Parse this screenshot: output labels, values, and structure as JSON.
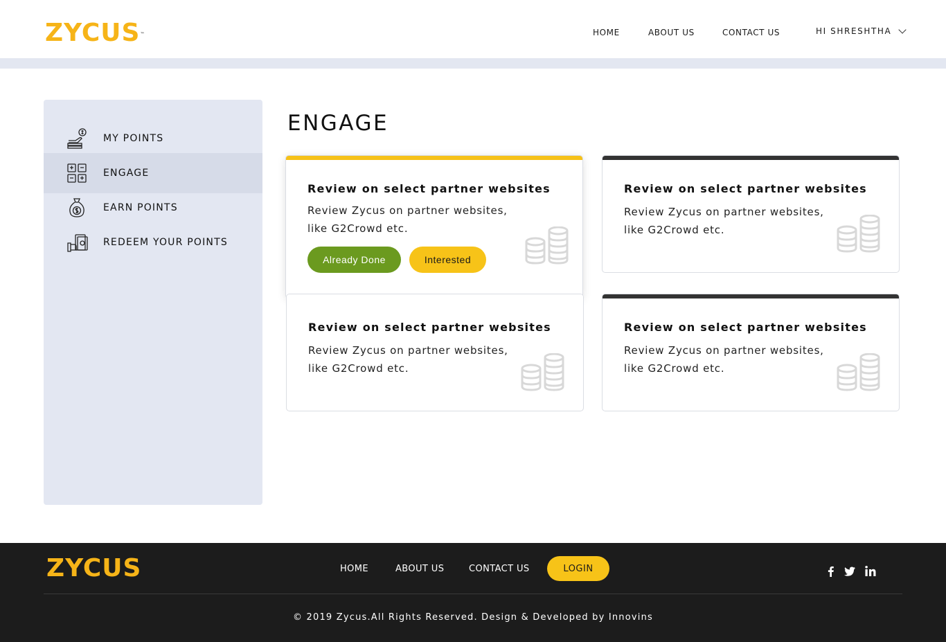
{
  "header": {
    "logo_text": "ZYCUS",
    "logo_tm": "™",
    "nav": [
      "HOME",
      "ABOUT US",
      "CONTACT US"
    ],
    "user_greeting": "HI SHRESHTHA"
  },
  "sidebar": {
    "items": [
      {
        "label": "MY POINTS",
        "icon": "hand-coin-icon",
        "active": false
      },
      {
        "label": "ENGAGE",
        "icon": "engage-grid-icon",
        "active": true
      },
      {
        "label": "EARN POINTS",
        "icon": "money-bag-icon",
        "active": false
      },
      {
        "label": "REDEEM YOUR POINTS",
        "icon": "redeem-hand-icon",
        "active": false
      }
    ]
  },
  "main": {
    "title": "ENGAGE",
    "cards": [
      {
        "title": "Review on select partner websites",
        "desc": "Review Zycus on partner websites, like G2Crowd etc.",
        "active": true,
        "btn_done": "Already Done",
        "btn_interested": "Interested"
      },
      {
        "title": "Review on select partner websites",
        "desc": "Review Zycus on partner websites, like G2Crowd etc.",
        "active": false
      },
      {
        "title": "Review on select partner websites",
        "desc": "Review Zycus on partner websites, like G2Crowd etc.",
        "active": false
      },
      {
        "title": "Review on select partner websites",
        "desc": "Review Zycus on partner websites, like G2Crowd etc.",
        "active": false
      }
    ]
  },
  "footer": {
    "logo_text": "ZYCUS",
    "nav": [
      "HOME",
      "ABOUT US",
      "CONTACT US"
    ],
    "login_label": "LOGIN",
    "social": [
      "facebook-icon",
      "twitter-icon",
      "linkedin-icon"
    ],
    "copyright": "© 2019 Zycus.All Rights Reserved. Design & Developed by Innovins"
  },
  "colors": {
    "accent": "#f7c318",
    "done_green": "#6b9a1f",
    "sidebar_bg": "#e3e7f2",
    "footer_bg": "#1c1c1c"
  }
}
